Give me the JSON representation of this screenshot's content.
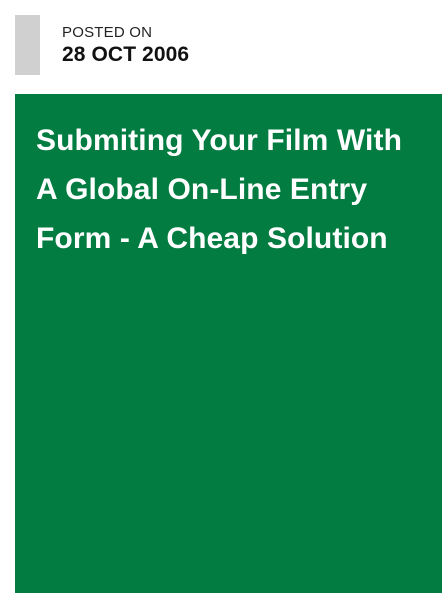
{
  "post": {
    "posted_on_label": "POSTED ON",
    "date": "28 OCT 2006",
    "title": "Submiting Your Film With A Global On-Line Entry Form - A Cheap Solution"
  },
  "colors": {
    "card_background": "#037c41",
    "meta_bar": "#d0d0d0",
    "title_text": "#ffffff"
  }
}
